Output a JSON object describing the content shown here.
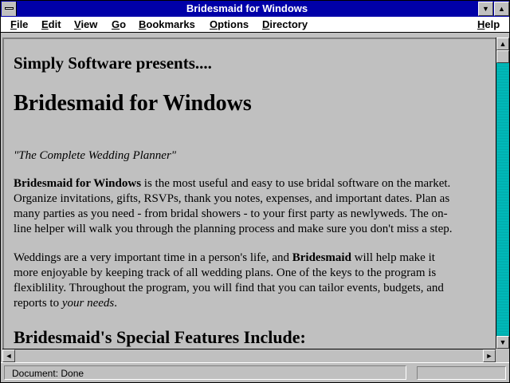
{
  "window": {
    "title": "Bridesmaid for Windows"
  },
  "menu": [
    {
      "label": "File",
      "accel": "F"
    },
    {
      "label": "Edit",
      "accel": "E"
    },
    {
      "label": "View",
      "accel": "V"
    },
    {
      "label": "Go",
      "accel": "G"
    },
    {
      "label": "Bookmarks",
      "accel": "B"
    },
    {
      "label": "Options",
      "accel": "O"
    },
    {
      "label": "Directory",
      "accel": "D"
    },
    {
      "label": "Help",
      "accel": "H"
    }
  ],
  "page": {
    "presenter": "Simply Software presents....",
    "heading": "Bridesmaid for Windows",
    "tagline": "\"The Complete Wedding Planner\"",
    "para1_bold": "Bridesmaid for Windows",
    "para1_rest": " is the most useful and easy to use bridal software on the market. Organize invitations, gifts, RSVPs, thank you notes, expenses, and important dates. Plan as many parties as you need - from bridal showers - to your first party as newlyweds. The on-line helper will walk you through the planning process and make sure you don't miss a step.",
    "para2_start": "Weddings are a very important time in a person's life, and ",
    "para2_bold": "Bridesmaid",
    "para2_mid": " will help make it more enjoyable by keeping track of all wedding plans. One of the keys to the program is flexiblility. Throughout the program, you will find that you can tailor events, budgets, and reports to ",
    "para2_italic": "your needs",
    "para2_end": ".",
    "features_heading": "Bridesmaid's Special Features Include:"
  },
  "status": {
    "text": "Document: Done"
  },
  "icons": {
    "minimize": "triangle-down-icon",
    "maximize": "triangle-up-icon",
    "scroll_up": "arrow-up-icon",
    "scroll_down": "arrow-down-icon",
    "scroll_left": "arrow-left-icon",
    "scroll_right": "arrow-right-icon"
  },
  "colors": {
    "titlebar": "#0000a8",
    "scrollbar": "#00a8a8",
    "background": "#c0c0c0"
  }
}
